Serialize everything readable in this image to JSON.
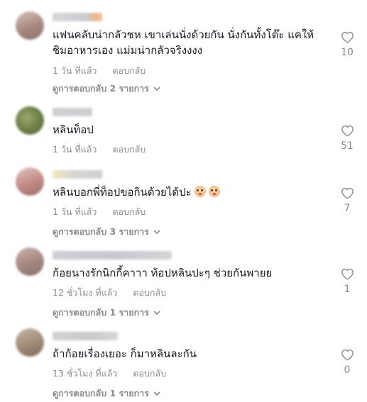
{
  "comments": [
    {
      "text_lines": [
        "แฟนคลับน่ากลัวชห เขาเล่นนั่งด้วยกัน นั่งกันทั้งโต๊ะ แคให้",
        "ชิมอาหารเอง แม่มน่ากลัวจริงงงง"
      ],
      "time": "1 วัน ที่แล้ว",
      "reply_label": "ตอบกลับ",
      "view_replies": "ดูการตอบกลับ 2 รายการ",
      "likes": "10",
      "avatar_color": "#b89a92"
    },
    {
      "text_lines": [
        "หลินท็อป"
      ],
      "time": "1 วัน ที่แล้ว",
      "reply_label": "ตอบกลับ",
      "view_replies": "",
      "likes": "51",
      "avatar_color": "#7a8a55"
    },
    {
      "text_lines": [
        "หลินบอกพี่ท็อปขอกินด้วยได้ปะ"
      ],
      "time": "1 วัน ที่แล้ว",
      "reply_label": "ตอบกลับ",
      "view_replies": "ดูการตอบกลับ 3 รายการ",
      "likes": "7",
      "emoji": [
        "flushed-face-emoji",
        "flushed-face-emoji"
      ],
      "avatar_color": "#c79a90"
    },
    {
      "text_lines": [
        "ก้อยนางรักนิกกี้คาาา ท้อปหลินปะๆ ช่วยกันพายย"
      ],
      "time": "12 ชั่วโมง ที่แล้ว",
      "reply_label": "ตอบกลับ",
      "view_replies": "ดูการตอบกลับ 1 รายการ",
      "likes": "1",
      "avatar_color": "#b0928c"
    },
    {
      "text_lines": [
        "ถ้าก้อยเรื่องเยอะ ก็มาหลินละกัน"
      ],
      "time": "13 ชั่วโมง ที่แล้ว",
      "reply_label": "ตอบกลับ",
      "view_replies": "ดูการตอบกลับ 1 รายการ",
      "likes": "0",
      "avatar_color": "#a58b7a"
    }
  ],
  "colors": {
    "text": "#161823",
    "secondary": "#8a8b91"
  }
}
